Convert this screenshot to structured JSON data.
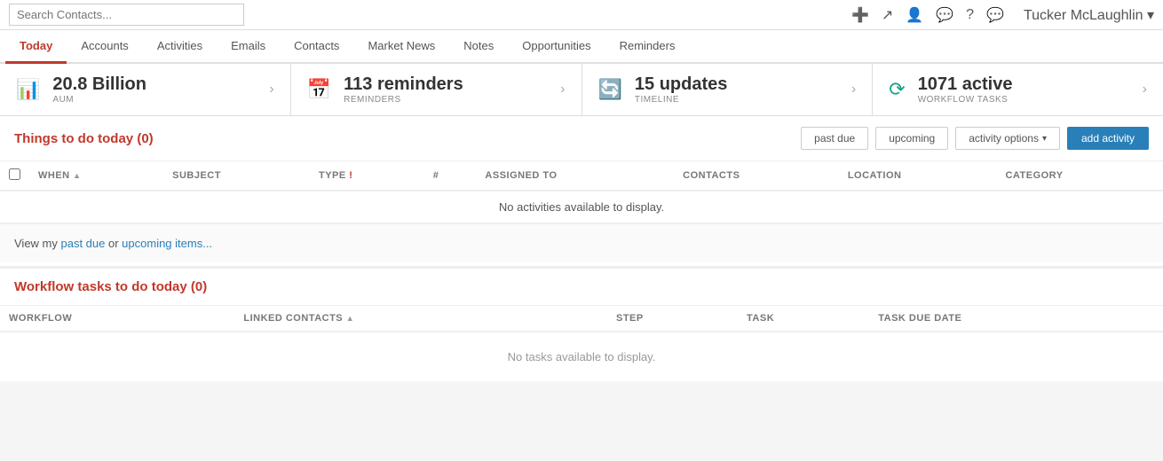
{
  "search": {
    "placeholder": "Search Contacts..."
  },
  "topbar": {
    "icons": [
      "+",
      "↗",
      "👤",
      "💬",
      "?",
      "💬"
    ],
    "user": "Tucker McLaughlin"
  },
  "nav": {
    "tabs": [
      "Today",
      "Accounts",
      "Activities",
      "Emails",
      "Contacts",
      "Market News",
      "Notes",
      "Opportunities",
      "Reminders"
    ],
    "active": "Today"
  },
  "cards": [
    {
      "icon": "📊",
      "iconClass": "red",
      "value": "20.8 Billion",
      "label": "AUM"
    },
    {
      "icon": "📅",
      "iconClass": "orange",
      "value": "113 reminders",
      "label": "REMINDERS"
    },
    {
      "icon": "🔄",
      "iconClass": "blue",
      "value": "15 updates",
      "label": "TIMELINE"
    },
    {
      "icon": "⟳",
      "iconClass": "teal",
      "value": "1071 active",
      "label": "WORKFLOW TASKS"
    }
  ],
  "activities": {
    "section_title": "Things to do today (0)",
    "btn_past_due": "past due",
    "btn_upcoming": "upcoming",
    "btn_activity_options": "activity options",
    "btn_add_activity": "add activity",
    "columns": [
      "WHEN",
      "SUBJECT",
      "TYPE",
      "#",
      "ASSIGNED TO",
      "CONTACTS",
      "LOCATION",
      "CATEGORY"
    ],
    "empty_message": "No activities available to display."
  },
  "view_links": {
    "prefix": "View my ",
    "past_due": "past due",
    "middle": " or ",
    "upcoming": "upcoming items..."
  },
  "workflow": {
    "section_title": "Workflow tasks to do today (0)",
    "columns": [
      "WORKFLOW",
      "LINKED CONTACTS",
      "STEP",
      "TASK",
      "TASK DUE DATE"
    ],
    "empty_message": "No tasks available to display."
  }
}
